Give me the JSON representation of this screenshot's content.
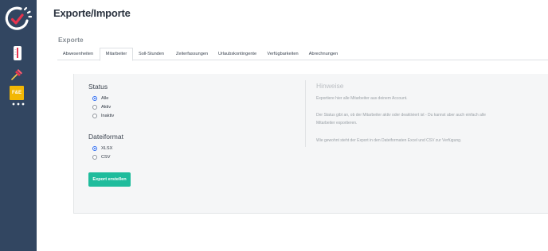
{
  "colors": {
    "sidebar": "#324661",
    "accent": "#1fbc9c",
    "radio": "#2f6df1",
    "logo_check": "#e8344e"
  },
  "sidebar": {
    "icons": [
      "app-logo-icon",
      "thermometer-icon",
      "pin-icon",
      "file-e-icon",
      "more-dots-icon"
    ],
    "file_icon_text": "F&E"
  },
  "page_title": "Exporte/Importe",
  "section_title": "Exporte",
  "tabs": [
    {
      "label": "Abwesenheiten",
      "active": false
    },
    {
      "label": "Mitarbeiter",
      "active": true
    },
    {
      "label": "Soll-Stunden",
      "active": false
    },
    {
      "label": "Zeiterfassungen",
      "active": false
    },
    {
      "label": "Urlaubskontingente",
      "active": false
    },
    {
      "label": "Verfügbarkeiten",
      "active": false
    },
    {
      "label": "Abrechnungen",
      "active": false
    }
  ],
  "status": {
    "heading": "Status",
    "options": [
      {
        "label": "Alle",
        "checked": true
      },
      {
        "label": "Aktiv",
        "checked": false
      },
      {
        "label": "Inaktiv",
        "checked": false
      }
    ]
  },
  "format": {
    "heading": "Dateiformat",
    "options": [
      {
        "label": "XLSX",
        "checked": true
      },
      {
        "label": "CSV",
        "checked": false
      }
    ]
  },
  "export_button": "Export erstellen",
  "hints": {
    "heading": "Hinweise",
    "lines": [
      "Exportiere hier alle Mitarbeiter aus deinem Account.",
      "Der Status gibt an, ob der Mitarbeiter aktiv oder deaktiviert ist - Du kannst aber auch einfach alle",
      "Mitarbeiter exportieren.",
      "Wie gewohnt steht der Export in den Dateiformaten Excel und CSV zur Verfügung."
    ]
  }
}
